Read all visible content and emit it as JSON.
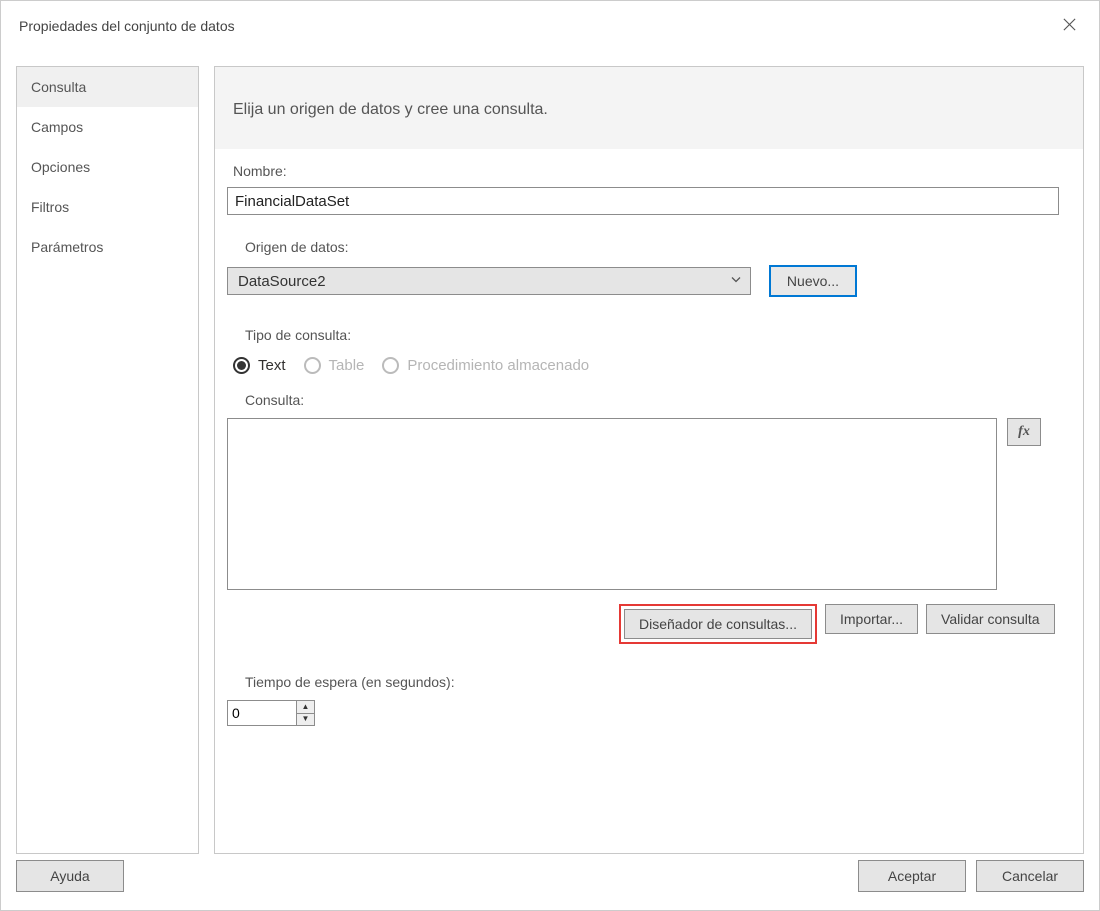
{
  "window": {
    "title": "Propiedades del conjunto de datos"
  },
  "sidebar": {
    "items": [
      {
        "label": "Consulta"
      },
      {
        "label": "Campos"
      },
      {
        "label": "Opciones"
      },
      {
        "label": "Filtros"
      },
      {
        "label": "Parámetros"
      }
    ]
  },
  "main": {
    "instruction": "Elija un origen de datos y cree una consulta.",
    "name_label": "Nombre:",
    "name_value": "FinancialDataSet",
    "datasource_label": "Origen de datos:",
    "datasource_value": "DataSource2",
    "new_button": "Nuevo...",
    "querytype_label": "Tipo de consulta:",
    "radios": {
      "text": "Text",
      "table": "Table",
      "sproc": "Procedimiento almacenado"
    },
    "query_label": "Consulta:",
    "query_value": "",
    "fx_label": "fx",
    "designer_button": "Diseñador de consultas...",
    "import_button": "Importar...",
    "validate_button": "Validar consulta",
    "timeout_label": "Tiempo de espera (en segundos):",
    "timeout_value": "0"
  },
  "footer": {
    "help": "Ayuda",
    "ok": "Aceptar",
    "cancel": "Cancelar"
  }
}
